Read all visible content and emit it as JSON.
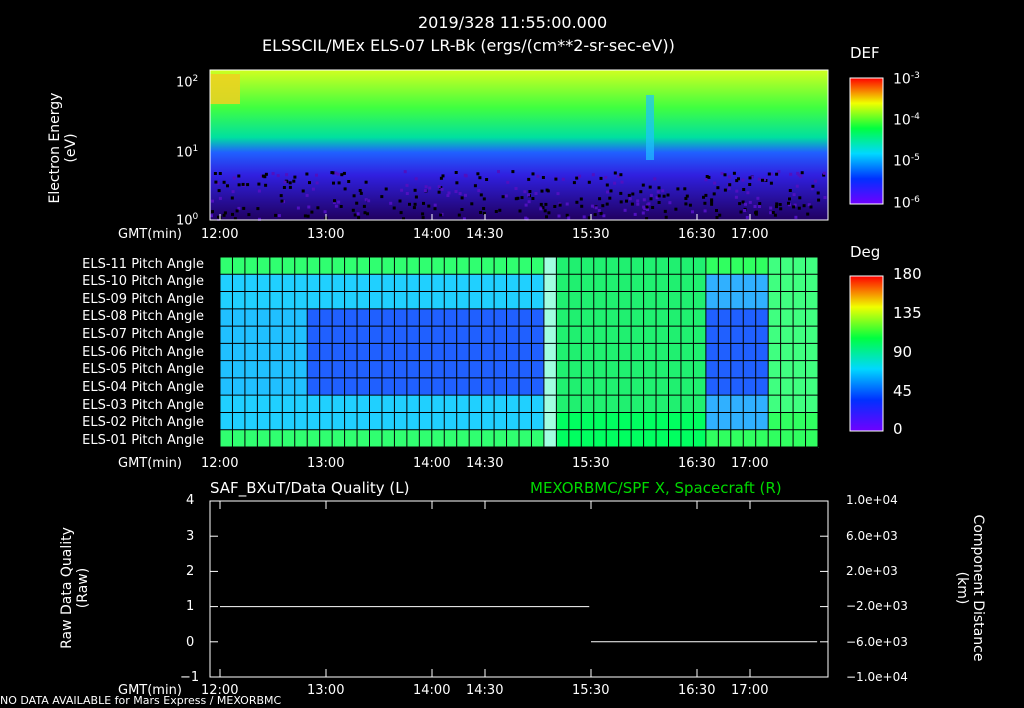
{
  "header": {
    "datetime": "2019/328 11:55:00.000",
    "instrument_title": "ELSSCIL/MEx ELS-07 LR-Bk  (ergs/(cm**2-sr-sec-eV))"
  },
  "chart_data": [
    {
      "type": "heatmap",
      "ylabel_line1": "Electron Energy",
      "ylabel_line2": "(eV)",
      "y_scale": "log",
      "ylim": [
        1,
        150
      ],
      "y_ticks": [
        {
          "base": "10",
          "exp": "0",
          "value": 1
        },
        {
          "base": "10",
          "exp": "1",
          "value": 10
        },
        {
          "base": "10",
          "exp": "2",
          "value": 100
        }
      ],
      "x_prefix": "GMT(min)",
      "x_ticks": [
        "12:00",
        "13:00",
        "14:00",
        "14:30",
        "15:30",
        "16:30",
        "17:00"
      ],
      "colorbar": {
        "label": "DEF",
        "scale": "log",
        "ticks": [
          {
            "base": "10",
            "exp": "-3"
          },
          {
            "base": "10",
            "exp": "-4"
          },
          {
            "base": "10",
            "exp": "-5"
          },
          {
            "base": "10",
            "exp": "-6"
          }
        ]
      }
    },
    {
      "type": "heatmap",
      "rows": [
        "ELS-11 Pitch Angle",
        "ELS-10 Pitch Angle",
        "ELS-09 Pitch Angle",
        "ELS-08 Pitch Angle",
        "ELS-07 Pitch Angle",
        "ELS-06 Pitch Angle",
        "ELS-05 Pitch Angle",
        "ELS-04 Pitch Angle",
        "ELS-03 Pitch Angle",
        "ELS-02 Pitch Angle",
        "ELS-01 Pitch Angle"
      ],
      "x_prefix": "GMT(min)",
      "x_ticks": [
        "12:00",
        "13:00",
        "14:00",
        "14:30",
        "15:30",
        "16:30",
        "17:00"
      ],
      "colorbar": {
        "label": "Deg",
        "range": [
          0,
          180
        ],
        "ticks": [
          "180",
          "135",
          "90",
          "45",
          "0"
        ]
      }
    },
    {
      "type": "line",
      "title_left": "SAF_BXuT/Data Quality (L)",
      "title_right": "MEXORBMC/SPF X, Spacecraft (R)",
      "ylabel_left_line1": "Raw Data Quality",
      "ylabel_left_line2": "(Raw)",
      "ylabel_right_line1": "Component Distance",
      "ylabel_right_line2": "(km)",
      "ylim_left": [
        -1,
        4
      ],
      "y_ticks_left": [
        "4",
        "3",
        "2",
        "1",
        "0",
        "−1"
      ],
      "y_ticks_right": [
        "1.0e+04",
        "6.0e+03",
        "2.0e+03",
        "−2.0e+03",
        "−6.0e+03",
        "−1.0e+04"
      ],
      "x_prefix": "GMT(min)",
      "x_ticks": [
        "12:00",
        "13:00",
        "14:00",
        "14:30",
        "15:30",
        "16:30",
        "17:00"
      ],
      "series": [
        {
          "segments": [
            {
              "x": [
                "12:00",
                "15:29"
              ],
              "y": [
                1,
                1
              ]
            },
            {
              "x": [
                "15:30",
                "17:38"
              ],
              "y": [
                0,
                0
              ]
            }
          ]
        }
      ]
    }
  ],
  "footer": {
    "notice": "NO DATA AVAILABLE for Mars  Express / MEXORBMC"
  },
  "colors": {
    "background": "#000000",
    "text": "#ffffff",
    "accent_green": "#00d800"
  }
}
